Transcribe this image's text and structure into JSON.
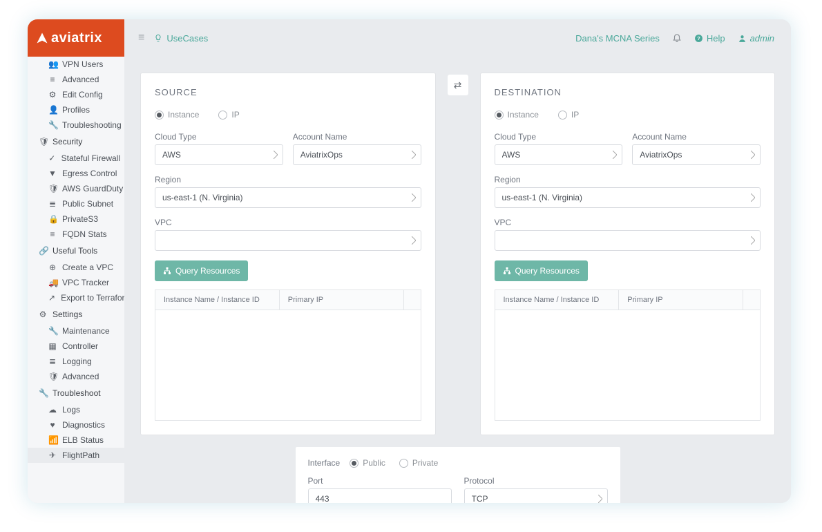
{
  "brand": "aviatrix",
  "topbar": {
    "usecases": "UseCases",
    "series": "Dana's MCNA Series",
    "help": "Help",
    "admin": "admin"
  },
  "sidebar": {
    "top_items": [
      {
        "icon": "users",
        "label": "VPN Users"
      },
      {
        "icon": "sliders",
        "label": "Advanced"
      },
      {
        "icon": "gear",
        "label": "Edit Config"
      },
      {
        "icon": "user",
        "label": "Profiles"
      },
      {
        "icon": "wrench",
        "label": "Troubleshooting"
      }
    ],
    "security_header": "Security",
    "security_items": [
      {
        "icon": "check",
        "label": "Stateful Firewall"
      },
      {
        "icon": "filter",
        "label": "Egress Control"
      },
      {
        "icon": "shield",
        "label": "AWS GuardDuty"
      },
      {
        "icon": "layers",
        "label": "Public Subnet"
      },
      {
        "icon": "lock",
        "label": "PrivateS3"
      },
      {
        "icon": "bars",
        "label": "FQDN Stats"
      }
    ],
    "tools_header": "Useful Tools",
    "tools_items": [
      {
        "icon": "plus",
        "label": "Create a VPC"
      },
      {
        "icon": "truck",
        "label": "VPC Tracker"
      },
      {
        "icon": "export",
        "label": "Export to Terraform"
      }
    ],
    "settings_header": "Settings",
    "settings_items": [
      {
        "icon": "wrench",
        "label": "Maintenance"
      },
      {
        "icon": "server",
        "label": "Controller"
      },
      {
        "icon": "list",
        "label": "Logging"
      },
      {
        "icon": "shield",
        "label": "Advanced"
      }
    ],
    "troubleshoot_header": "Troubleshoot",
    "troubleshoot_items": [
      {
        "icon": "cloud",
        "label": "Logs"
      },
      {
        "icon": "heart",
        "label": "Diagnostics"
      },
      {
        "icon": "signal",
        "label": "ELB Status"
      },
      {
        "icon": "plane",
        "label": "FlightPath"
      }
    ]
  },
  "source": {
    "title": "SOURCE",
    "radio_instance": "Instance",
    "radio_ip": "IP",
    "cloud_label": "Cloud Type",
    "cloud_value": "AWS",
    "account_label": "Account Name",
    "account_value": "AviatrixOps",
    "region_label": "Region",
    "region_value": "us-east-1 (N. Virginia)",
    "vpc_label": "VPC",
    "vpc_value": "",
    "query_btn": "Query Resources",
    "col1": "Instance Name / Instance ID",
    "col2": "Primary IP"
  },
  "destination": {
    "title": "DESTINATION",
    "radio_instance": "Instance",
    "radio_ip": "IP",
    "cloud_label": "Cloud Type",
    "cloud_value": "AWS",
    "account_label": "Account Name",
    "account_value": "AviatrixOps",
    "region_label": "Region",
    "region_value": "us-east-1 (N. Virginia)",
    "vpc_label": "VPC",
    "vpc_value": "",
    "query_btn": "Query Resources",
    "col1": "Instance Name / Instance ID",
    "col2": "Primary IP"
  },
  "bottom": {
    "interface_label": "Interface",
    "public": "Public",
    "private": "Private",
    "port_label": "Port",
    "port_value": "443",
    "protocol_label": "Protocol",
    "protocol_value": "TCP"
  }
}
